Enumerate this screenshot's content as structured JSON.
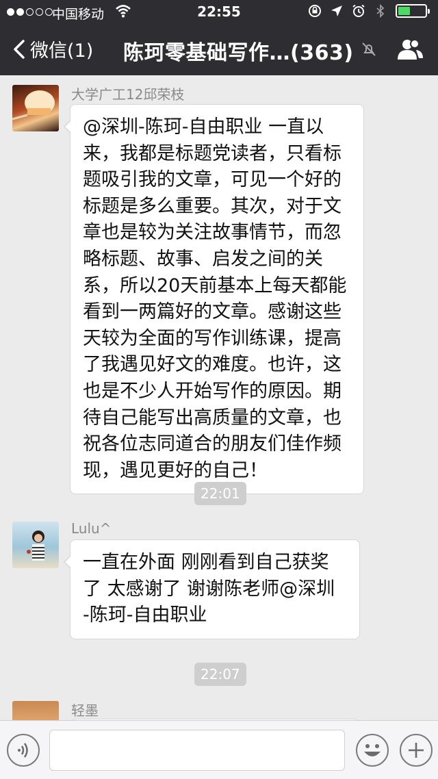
{
  "status_bar": {
    "carrier": "中国移动",
    "time": "22:55",
    "battery_level": 0.45,
    "signal_bars": 2
  },
  "nav": {
    "back_label": "微信(1)",
    "title": "陈珂零基础写作…(363)",
    "icons": [
      "chevron-left-icon",
      "mute-icon",
      "group-members-icon"
    ]
  },
  "messages": [
    {
      "sender": "大学广工12邱荣枝",
      "lines": [
        "@深圳-陈珂-自由职业 一直以",
        "来，我都是标题党读者，只看标",
        "题吸引我的文章，可见一个好的",
        "标题是多么重要。其次，对于文",
        "章也是较为关注故事情节，而忽",
        "略标题、故事、启发之间的关",
        "系，所以20天前基本上每天都能",
        "看到一两篇好的文章。感谢这些",
        "天较为全面的写作训练课，提高",
        "了我遇见好文的难度。也许，这",
        "也是不少人开始写作的原因。期",
        "待自己能写出高质量的文章，也",
        "祝各位志同道合的朋友们佳作频",
        "现，遇见更好的自己！"
      ]
    },
    {
      "timestamp": "22:01"
    },
    {
      "sender": "Lulu^",
      "lines": [
        "一直在外面  刚刚看到自己获奖",
        "了  太感谢了  谢谢陈老师@深圳",
        "-陈珂-自由职业"
      ]
    },
    {
      "timestamp": "22:07"
    },
    {
      "sender": "轻墨",
      "lines": []
    }
  ],
  "input_bar": {
    "icons": [
      "voice-icon",
      "emoji-icon",
      "plus-icon"
    ],
    "value": ""
  },
  "colors": {
    "nav_bg": "#2d2d32",
    "chat_bg": "#ebebeb",
    "timestamp_bg": "#cecece",
    "battery": "#4cd964"
  }
}
